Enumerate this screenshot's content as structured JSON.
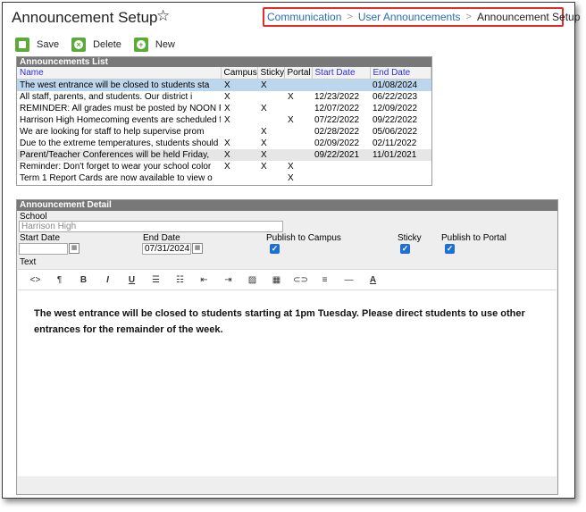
{
  "page": {
    "title": "Announcement Setup"
  },
  "breadcrumb": {
    "items": [
      "Communication",
      "User Announcements",
      "Announcement Setup"
    ]
  },
  "toolbar": {
    "save_label": "Save",
    "delete_label": "Delete",
    "new_label": "New"
  },
  "list": {
    "header": "Announcements List",
    "columns": [
      "Name",
      "Campus",
      "Sticky",
      "Portal",
      "Start Date",
      "End Date"
    ],
    "rows": [
      [
        "The west entrance will be closed to students sta",
        "X",
        "X",
        "",
        "",
        "01/08/2024"
      ],
      [
        "All staff, parents, and students. Our district i",
        "X",
        "",
        "X",
        "12/23/2022",
        "06/22/2023"
      ],
      [
        "REMINDER: All grades must be posted by NOON Frid",
        "X",
        "X",
        "",
        "12/07/2022",
        "12/09/2022"
      ],
      [
        "Harrison High Homecoming events are scheduled fo",
        "X",
        "",
        "X",
        "07/22/2022",
        "09/22/2022"
      ],
      [
        "We are looking for staff to help supervise prom",
        "",
        "X",
        "",
        "02/28/2022",
        "05/06/2022"
      ],
      [
        "Due to the extreme temperatures, students should",
        "X",
        "X",
        "",
        "02/09/2022",
        "02/11/2022"
      ],
      [
        "Parent/Teacher Conferences will be held Friday,",
        "X",
        "X",
        "",
        "09/22/2021",
        "11/01/2021"
      ],
      [
        "Reminder: Don't forget to wear your school color",
        "X",
        "X",
        "X",
        "",
        ""
      ],
      [
        "Term 1 Report Cards are now available to view o",
        "",
        "",
        "X",
        "",
        ""
      ]
    ]
  },
  "detail": {
    "header": "Announcement Detail",
    "school_label": "School",
    "school_value": "Harrison High",
    "start_date_label": "Start Date",
    "start_date_value": "",
    "end_date_label": "End Date",
    "end_date_value": "07/31/2024",
    "publish_campus_label": "Publish to Campus",
    "sticky_label": "Sticky",
    "publish_portal_label": "Publish to Portal",
    "publish_campus_checked": true,
    "sticky_checked": true,
    "publish_portal_checked": true,
    "text_label": "Text",
    "editor_buttons": [
      "code-view",
      "paragraph",
      "bold",
      "italic",
      "underline",
      "bullet-list",
      "numbered-list",
      "outdent",
      "indent",
      "image",
      "table",
      "link",
      "align",
      "horizontal-rule",
      "font-color"
    ],
    "editor_text": {
      "part1": "The ",
      "part2": "west entrance",
      "part3": " will be closed to students starting at 1pm Tuesday. Please direct students to use other entrances for the remainder of the week."
    }
  },
  "colors": {
    "accent_green": "#5cab3a",
    "header_gray": "#787878",
    "selected_row": "#bcd6ee",
    "breadcrumb_highlight": "#e32c2c",
    "link_blue": "#2a6bb8"
  }
}
